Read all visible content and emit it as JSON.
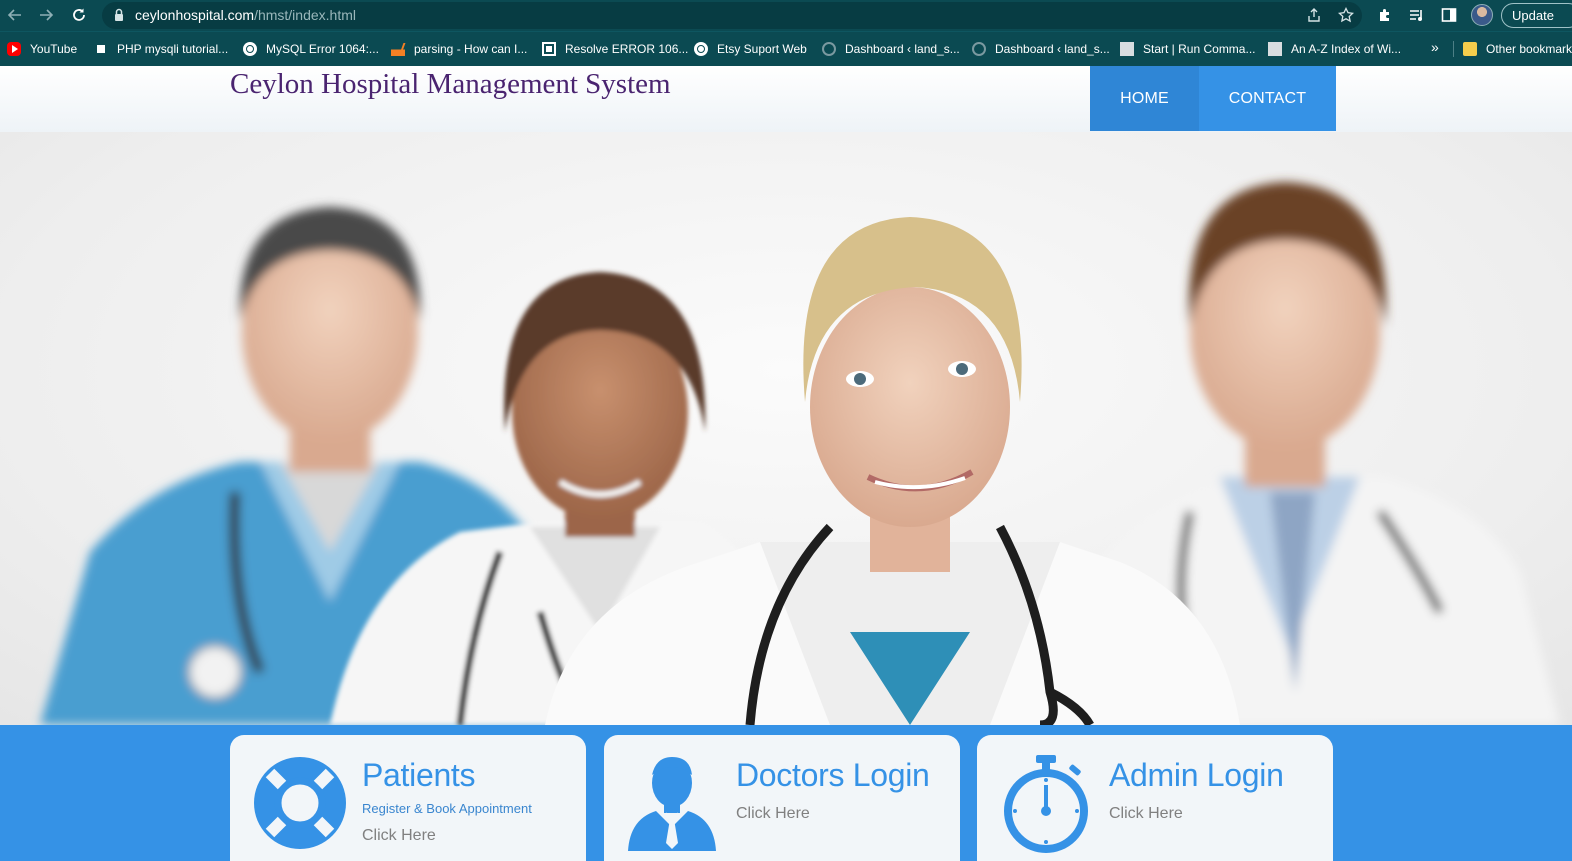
{
  "browser": {
    "url_host": "ceylonhospital.com",
    "url_path": "/hmst/index.html",
    "update_label": "Update",
    "bookmarks": [
      {
        "label": "YouTube",
        "icon": "youtube-icon"
      },
      {
        "label": "PHP mysqli tutorial...",
        "icon": "page-icon"
      },
      {
        "label": "MySQL Error 1064:...",
        "icon": "globe-icon"
      },
      {
        "label": "parsing - How can I...",
        "icon": "stackoverflow-icon"
      },
      {
        "label": "Resolve ERROR 106...",
        "icon": "error-page-icon"
      },
      {
        "label": "Etsy Suport Web",
        "icon": "globe-icon"
      },
      {
        "label": "Dashboard ‹ land_s...",
        "icon": "wordpress-icon"
      },
      {
        "label": "Dashboard ‹ land_s...",
        "icon": "wordpress-icon"
      },
      {
        "label": "Start | Run Comma...",
        "icon": "page-icon"
      },
      {
        "label": "An A-Z Index of Wi...",
        "icon": "page-icon"
      }
    ],
    "more_bookmarks": "»",
    "other_bookmarks": "Other bookmarks"
  },
  "site": {
    "title": "Ceylon Hospital Management System",
    "nav": {
      "home": "HOME",
      "contact": "CONTACT"
    },
    "cards": {
      "patients": {
        "title": "Patients",
        "subtitle": "Register & Book Appointment",
        "link": "Click Here",
        "icon": "lifebuoy-icon"
      },
      "doctors": {
        "title": "Doctors Login",
        "link": "Click Here",
        "icon": "doctor-icon"
      },
      "admin": {
        "title": "Admin Login",
        "link": "Click Here",
        "icon": "stopwatch-icon"
      }
    }
  },
  "colors": {
    "browser_bg": "#0b4a52",
    "title_purple": "#4a2470",
    "accent_blue": "#3592e6",
    "nav_home_blue": "#2f86d6"
  }
}
